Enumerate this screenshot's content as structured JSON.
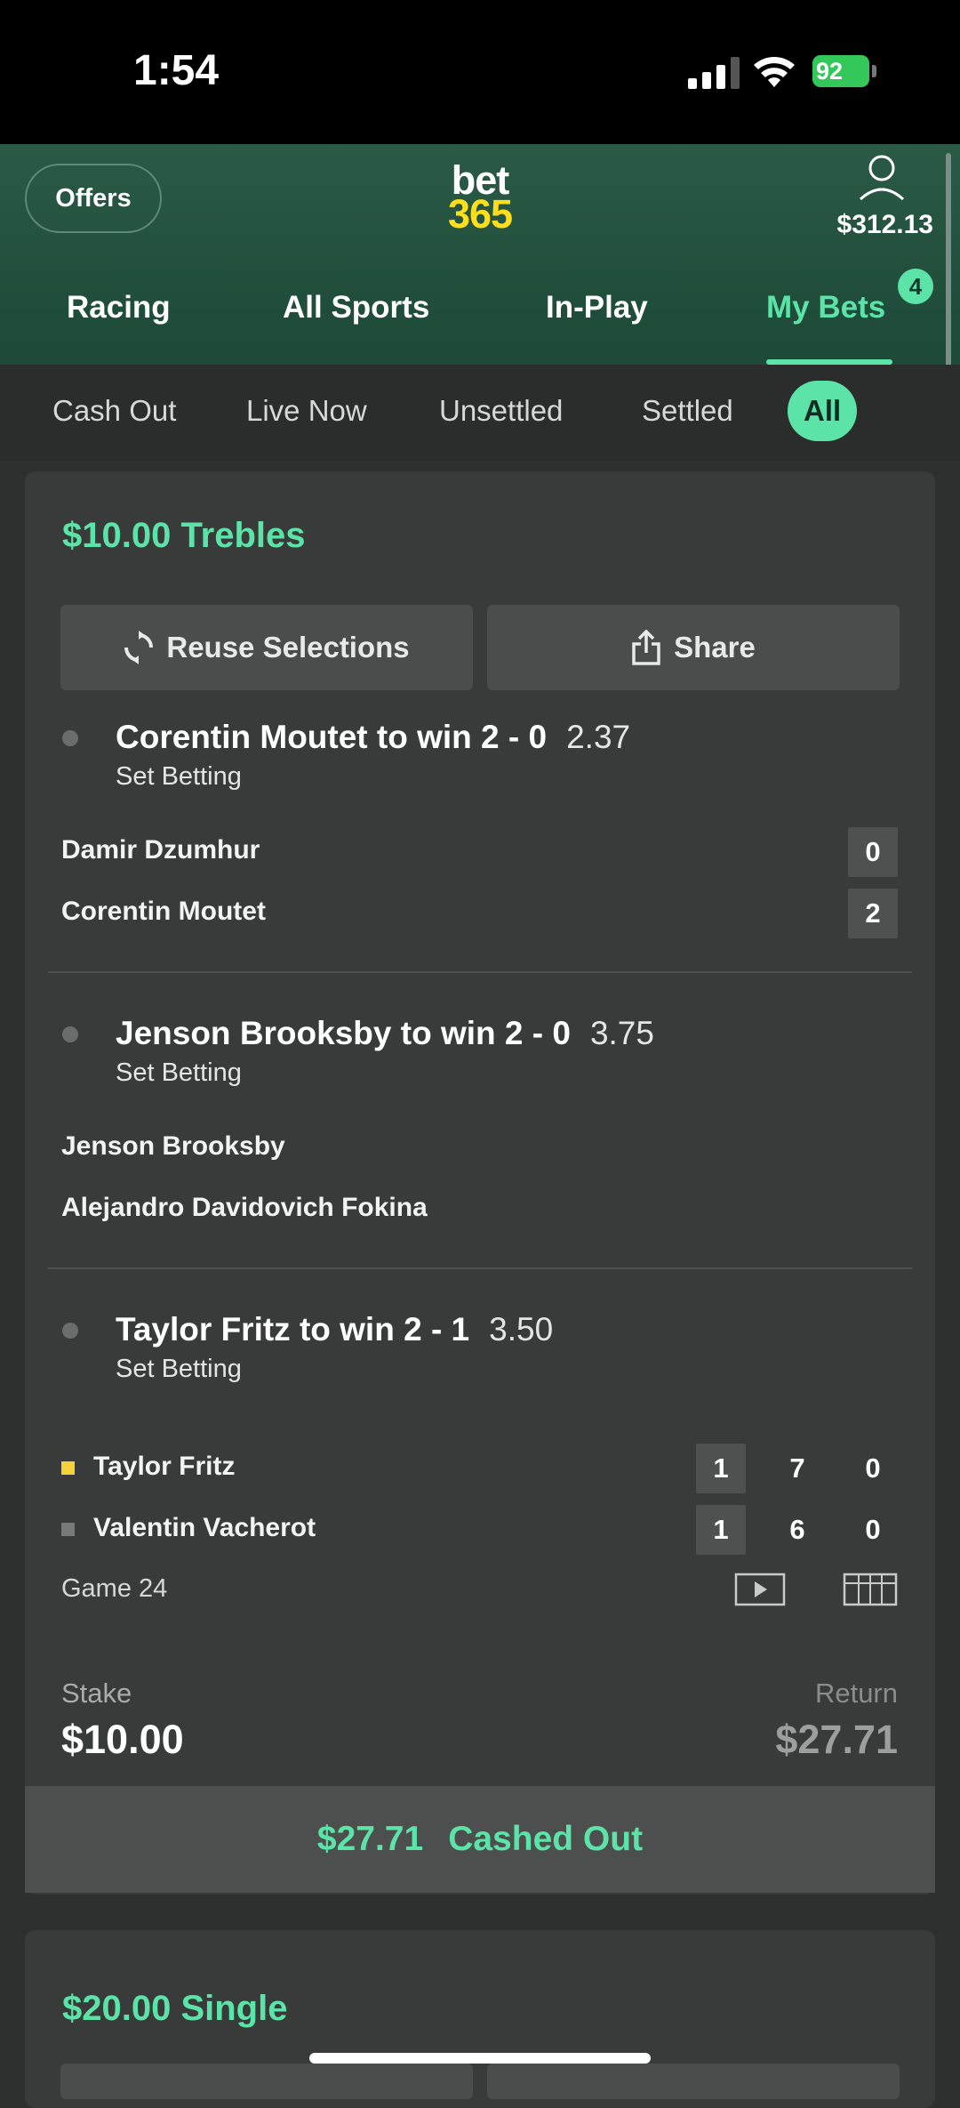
{
  "status_bar": {
    "time": "1:54",
    "battery": "92"
  },
  "header": {
    "offers_label": "Offers",
    "logo_top": "bet",
    "logo_bottom": "365",
    "balance": "$312.13",
    "tabs": [
      {
        "label": "Racing"
      },
      {
        "label": "All Sports"
      },
      {
        "label": "In-Play"
      },
      {
        "label": "My Bets",
        "badge": "4"
      }
    ]
  },
  "filters": [
    "Cash Out",
    "Live Now",
    "Unsettled",
    "Settled",
    "All"
  ],
  "bets": [
    {
      "title": "$10.00 Trebles",
      "reuse_label": "Reuse Selections",
      "share_label": "Share",
      "selections": [
        {
          "title": "Corentin Moutet to win 2 - 0",
          "odds": "2.37",
          "market": "Set Betting",
          "players": [
            {
              "name": "Damir Dzumhur",
              "scores": [
                "0"
              ]
            },
            {
              "name": "Corentin Moutet",
              "scores": [
                "2"
              ]
            }
          ]
        },
        {
          "title": "Jenson Brooksby to win 2 - 0",
          "odds": "3.75",
          "market": "Set Betting",
          "players": [
            {
              "name": "Jenson Brooksby"
            },
            {
              "name": "Alejandro Davidovich Fokina"
            }
          ]
        },
        {
          "title": "Taylor Fritz to win 2 - 1",
          "odds": "3.50",
          "market": "Set Betting",
          "players": [
            {
              "name": "Taylor Fritz",
              "scores": [
                "1",
                "7",
                "0"
              ]
            },
            {
              "name": "Valentin Vacherot",
              "scores": [
                "1",
                "6",
                "0"
              ]
            }
          ],
          "game_label": "Game 24"
        }
      ],
      "stake_label": "Stake",
      "stake": "$10.00",
      "return_label": "Return",
      "return": "$27.71",
      "cashout_amount": "$27.71",
      "cashout_status": "Cashed Out"
    },
    {
      "title": "$20.00 Single"
    }
  ],
  "colors": {
    "accent": "#5ce4a8",
    "header_green": "#245240",
    "logo_yellow": "#ffdf1b",
    "card_bg": "#383b3a"
  }
}
